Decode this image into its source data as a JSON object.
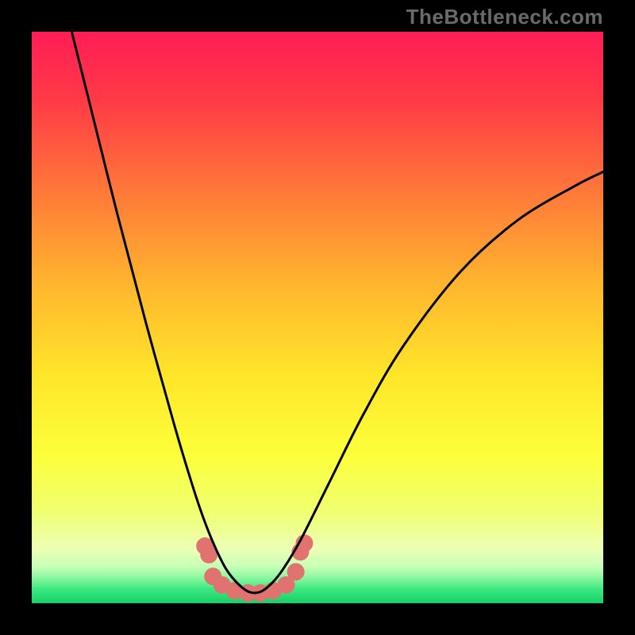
{
  "watermark": "TheBottleneck.com",
  "chart_data": {
    "type": "line",
    "title": "",
    "xlabel": "",
    "ylabel": "",
    "xlim": [
      0,
      1
    ],
    "ylim": [
      0,
      1
    ],
    "series": [
      {
        "name": "bottleneck-curve",
        "x": [
          0.07,
          0.1,
          0.15,
          0.2,
          0.25,
          0.28,
          0.3,
          0.32,
          0.34,
          0.36,
          0.38,
          0.4,
          0.42,
          0.44,
          0.47,
          0.52,
          0.58,
          0.65,
          0.75,
          0.85,
          0.95,
          1.0
        ],
        "values": [
          1.0,
          0.88,
          0.68,
          0.49,
          0.31,
          0.21,
          0.15,
          0.1,
          0.06,
          0.035,
          0.02,
          0.02,
          0.035,
          0.06,
          0.11,
          0.21,
          0.33,
          0.45,
          0.58,
          0.67,
          0.73,
          0.755
        ]
      }
    ],
    "markers": [
      {
        "x": 0.303,
        "y": 0.1
      },
      {
        "x": 0.31,
        "y": 0.085
      },
      {
        "x": 0.317,
        "y": 0.047
      },
      {
        "x": 0.333,
        "y": 0.032
      },
      {
        "x": 0.355,
        "y": 0.022
      },
      {
        "x": 0.378,
        "y": 0.018
      },
      {
        "x": 0.4,
        "y": 0.018
      },
      {
        "x": 0.422,
        "y": 0.022
      },
      {
        "x": 0.445,
        "y": 0.032
      },
      {
        "x": 0.462,
        "y": 0.055
      },
      {
        "x": 0.47,
        "y": 0.09
      },
      {
        "x": 0.477,
        "y": 0.105
      }
    ],
    "gradient_stops": [
      {
        "offset": 0.0,
        "color": "#ff1d55"
      },
      {
        "offset": 0.12,
        "color": "#ff3a46"
      },
      {
        "offset": 0.28,
        "color": "#ff7839"
      },
      {
        "offset": 0.45,
        "color": "#ffb82e"
      },
      {
        "offset": 0.6,
        "color": "#ffe52a"
      },
      {
        "offset": 0.74,
        "color": "#fcff3a"
      },
      {
        "offset": 0.84,
        "color": "#f0ff70"
      },
      {
        "offset": 0.905,
        "color": "#ecffb6"
      },
      {
        "offset": 0.935,
        "color": "#c8ffb8"
      },
      {
        "offset": 0.955,
        "color": "#8cf7a0"
      },
      {
        "offset": 0.975,
        "color": "#3de881"
      },
      {
        "offset": 1.0,
        "color": "#17d068"
      }
    ],
    "marker_color": "#e0736f",
    "curve_color": "#000000"
  }
}
